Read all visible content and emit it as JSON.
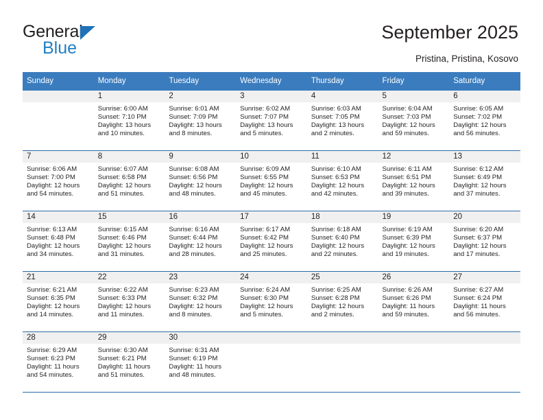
{
  "brand": {
    "name_part1": "General",
    "name_part2": "Blue",
    "triangle_color": "#1f72b8",
    "blue_color": "#1f7fc4"
  },
  "header": {
    "title": "September 2025",
    "subtitle": "Pristina, Pristina, Kosovo"
  },
  "theme": {
    "header_bg": "#3a7cbe",
    "week_divider": "#2b6ca8",
    "daynum_bg": "#f0f0f0",
    "text": "#231f20"
  },
  "calendar": {
    "weekday_headers": [
      "Sunday",
      "Monday",
      "Tuesday",
      "Wednesday",
      "Thursday",
      "Friday",
      "Saturday"
    ],
    "weeks": [
      [
        {
          "day": "",
          "empty": true,
          "sunrise": "",
          "sunset": "",
          "daylight_l1": "",
          "daylight_l2": ""
        },
        {
          "day": "1",
          "sunrise": "Sunrise: 6:00 AM",
          "sunset": "Sunset: 7:10 PM",
          "daylight_l1": "Daylight: 13 hours",
          "daylight_l2": "and 10 minutes."
        },
        {
          "day": "2",
          "sunrise": "Sunrise: 6:01 AM",
          "sunset": "Sunset: 7:09 PM",
          "daylight_l1": "Daylight: 13 hours",
          "daylight_l2": "and 8 minutes."
        },
        {
          "day": "3",
          "sunrise": "Sunrise: 6:02 AM",
          "sunset": "Sunset: 7:07 PM",
          "daylight_l1": "Daylight: 13 hours",
          "daylight_l2": "and 5 minutes."
        },
        {
          "day": "4",
          "sunrise": "Sunrise: 6:03 AM",
          "sunset": "Sunset: 7:05 PM",
          "daylight_l1": "Daylight: 13 hours",
          "daylight_l2": "and 2 minutes."
        },
        {
          "day": "5",
          "sunrise": "Sunrise: 6:04 AM",
          "sunset": "Sunset: 7:03 PM",
          "daylight_l1": "Daylight: 12 hours",
          "daylight_l2": "and 59 minutes."
        },
        {
          "day": "6",
          "sunrise": "Sunrise: 6:05 AM",
          "sunset": "Sunset: 7:02 PM",
          "daylight_l1": "Daylight: 12 hours",
          "daylight_l2": "and 56 minutes."
        }
      ],
      [
        {
          "day": "7",
          "sunrise": "Sunrise: 6:06 AM",
          "sunset": "Sunset: 7:00 PM",
          "daylight_l1": "Daylight: 12 hours",
          "daylight_l2": "and 54 minutes."
        },
        {
          "day": "8",
          "sunrise": "Sunrise: 6:07 AM",
          "sunset": "Sunset: 6:58 PM",
          "daylight_l1": "Daylight: 12 hours",
          "daylight_l2": "and 51 minutes."
        },
        {
          "day": "9",
          "sunrise": "Sunrise: 6:08 AM",
          "sunset": "Sunset: 6:56 PM",
          "daylight_l1": "Daylight: 12 hours",
          "daylight_l2": "and 48 minutes."
        },
        {
          "day": "10",
          "sunrise": "Sunrise: 6:09 AM",
          "sunset": "Sunset: 6:55 PM",
          "daylight_l1": "Daylight: 12 hours",
          "daylight_l2": "and 45 minutes."
        },
        {
          "day": "11",
          "sunrise": "Sunrise: 6:10 AM",
          "sunset": "Sunset: 6:53 PM",
          "daylight_l1": "Daylight: 12 hours",
          "daylight_l2": "and 42 minutes."
        },
        {
          "day": "12",
          "sunrise": "Sunrise: 6:11 AM",
          "sunset": "Sunset: 6:51 PM",
          "daylight_l1": "Daylight: 12 hours",
          "daylight_l2": "and 39 minutes."
        },
        {
          "day": "13",
          "sunrise": "Sunrise: 6:12 AM",
          "sunset": "Sunset: 6:49 PM",
          "daylight_l1": "Daylight: 12 hours",
          "daylight_l2": "and 37 minutes."
        }
      ],
      [
        {
          "day": "14",
          "sunrise": "Sunrise: 6:13 AM",
          "sunset": "Sunset: 6:48 PM",
          "daylight_l1": "Daylight: 12 hours",
          "daylight_l2": "and 34 minutes."
        },
        {
          "day": "15",
          "sunrise": "Sunrise: 6:15 AM",
          "sunset": "Sunset: 6:46 PM",
          "daylight_l1": "Daylight: 12 hours",
          "daylight_l2": "and 31 minutes."
        },
        {
          "day": "16",
          "sunrise": "Sunrise: 6:16 AM",
          "sunset": "Sunset: 6:44 PM",
          "daylight_l1": "Daylight: 12 hours",
          "daylight_l2": "and 28 minutes."
        },
        {
          "day": "17",
          "sunrise": "Sunrise: 6:17 AM",
          "sunset": "Sunset: 6:42 PM",
          "daylight_l1": "Daylight: 12 hours",
          "daylight_l2": "and 25 minutes."
        },
        {
          "day": "18",
          "sunrise": "Sunrise: 6:18 AM",
          "sunset": "Sunset: 6:40 PM",
          "daylight_l1": "Daylight: 12 hours",
          "daylight_l2": "and 22 minutes."
        },
        {
          "day": "19",
          "sunrise": "Sunrise: 6:19 AM",
          "sunset": "Sunset: 6:39 PM",
          "daylight_l1": "Daylight: 12 hours",
          "daylight_l2": "and 19 minutes."
        },
        {
          "day": "20",
          "sunrise": "Sunrise: 6:20 AM",
          "sunset": "Sunset: 6:37 PM",
          "daylight_l1": "Daylight: 12 hours",
          "daylight_l2": "and 17 minutes."
        }
      ],
      [
        {
          "day": "21",
          "sunrise": "Sunrise: 6:21 AM",
          "sunset": "Sunset: 6:35 PM",
          "daylight_l1": "Daylight: 12 hours",
          "daylight_l2": "and 14 minutes."
        },
        {
          "day": "22",
          "sunrise": "Sunrise: 6:22 AM",
          "sunset": "Sunset: 6:33 PM",
          "daylight_l1": "Daylight: 12 hours",
          "daylight_l2": "and 11 minutes."
        },
        {
          "day": "23",
          "sunrise": "Sunrise: 6:23 AM",
          "sunset": "Sunset: 6:32 PM",
          "daylight_l1": "Daylight: 12 hours",
          "daylight_l2": "and 8 minutes."
        },
        {
          "day": "24",
          "sunrise": "Sunrise: 6:24 AM",
          "sunset": "Sunset: 6:30 PM",
          "daylight_l1": "Daylight: 12 hours",
          "daylight_l2": "and 5 minutes."
        },
        {
          "day": "25",
          "sunrise": "Sunrise: 6:25 AM",
          "sunset": "Sunset: 6:28 PM",
          "daylight_l1": "Daylight: 12 hours",
          "daylight_l2": "and 2 minutes."
        },
        {
          "day": "26",
          "sunrise": "Sunrise: 6:26 AM",
          "sunset": "Sunset: 6:26 PM",
          "daylight_l1": "Daylight: 11 hours",
          "daylight_l2": "and 59 minutes."
        },
        {
          "day": "27",
          "sunrise": "Sunrise: 6:27 AM",
          "sunset": "Sunset: 6:24 PM",
          "daylight_l1": "Daylight: 11 hours",
          "daylight_l2": "and 56 minutes."
        }
      ],
      [
        {
          "day": "28",
          "sunrise": "Sunrise: 6:29 AM",
          "sunset": "Sunset: 6:23 PM",
          "daylight_l1": "Daylight: 11 hours",
          "daylight_l2": "and 54 minutes."
        },
        {
          "day": "29",
          "sunrise": "Sunrise: 6:30 AM",
          "sunset": "Sunset: 6:21 PM",
          "daylight_l1": "Daylight: 11 hours",
          "daylight_l2": "and 51 minutes."
        },
        {
          "day": "30",
          "sunrise": "Sunrise: 6:31 AM",
          "sunset": "Sunset: 6:19 PM",
          "daylight_l1": "Daylight: 11 hours",
          "daylight_l2": "and 48 minutes."
        },
        {
          "day": "",
          "empty": true,
          "sunrise": "",
          "sunset": "",
          "daylight_l1": "",
          "daylight_l2": ""
        },
        {
          "day": "",
          "empty": true,
          "sunrise": "",
          "sunset": "",
          "daylight_l1": "",
          "daylight_l2": ""
        },
        {
          "day": "",
          "empty": true,
          "sunrise": "",
          "sunset": "",
          "daylight_l1": "",
          "daylight_l2": ""
        },
        {
          "day": "",
          "empty": true,
          "sunrise": "",
          "sunset": "",
          "daylight_l1": "",
          "daylight_l2": ""
        }
      ]
    ]
  }
}
